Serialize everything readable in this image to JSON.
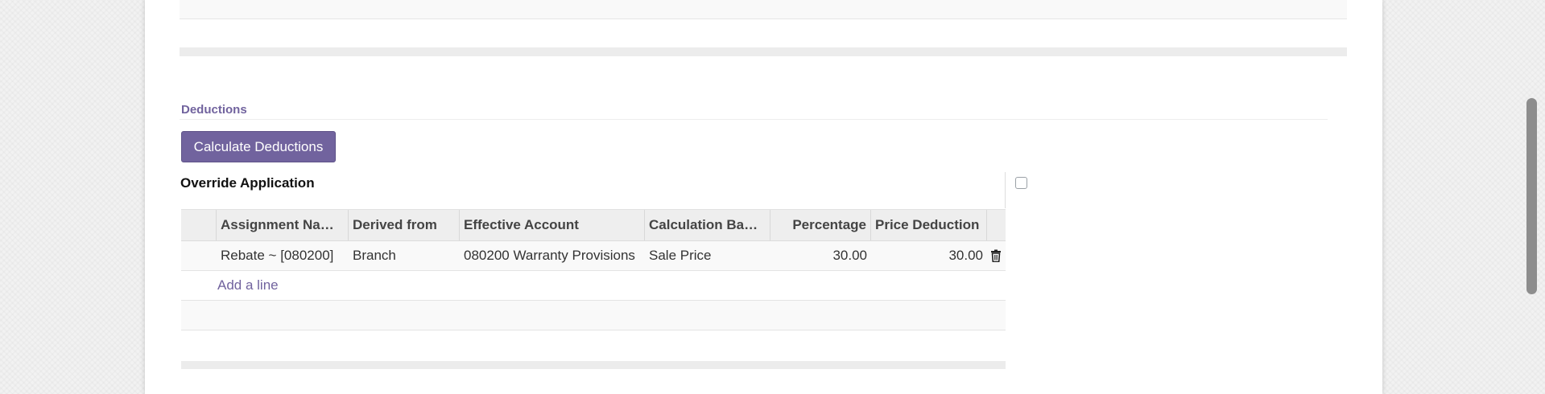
{
  "section": {
    "title": "Deductions",
    "calculate_button": "Calculate Deductions",
    "override_label": "Override Application",
    "override_checked": false
  },
  "table": {
    "columns": [
      "Assignment Na…",
      "Derived from",
      "Effective Account",
      "Calculation Ba…",
      "Percentage",
      "Price Deduction"
    ],
    "rows": [
      {
        "assignment_name": "Rebate ~ [080200]",
        "derived_from": "Branch",
        "effective_account": "080200 Warranty Provisions",
        "calculation_base": "Sale Price",
        "percentage": "30.00",
        "price_deduction": "30.00"
      }
    ],
    "add_line_label": "Add a line"
  },
  "icons": {
    "row_delete": "trash-icon"
  },
  "colors": {
    "accent": "#71639e",
    "header_bg": "#eeeeee",
    "row_bg": "#f9f9f9"
  }
}
